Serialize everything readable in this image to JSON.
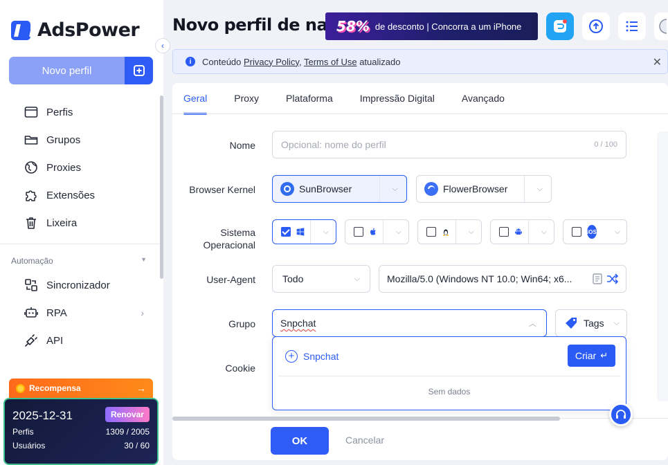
{
  "app": {
    "brand": "AdsPower"
  },
  "sidebar": {
    "new_profile_label": "Novo perfil",
    "items": [
      {
        "label": "Perfis",
        "icon": "profiles-icon"
      },
      {
        "label": "Grupos",
        "icon": "folder-icon"
      },
      {
        "label": "Proxies",
        "icon": "globe-icon"
      },
      {
        "label": "Extensões",
        "icon": "puzzle-icon"
      },
      {
        "label": "Lixeira",
        "icon": "trash-icon"
      }
    ],
    "automation_title": "Automação",
    "automation_items": [
      {
        "label": "Sincronizador",
        "icon": "sync-icon"
      },
      {
        "label": "RPA",
        "icon": "robot-icon"
      },
      {
        "label": "API",
        "icon": "plug-icon"
      }
    ],
    "reward_label": "Recompensa",
    "plan": {
      "date": "2025-12-31",
      "renew_label": "Renovar",
      "profiles_label": "Perfis",
      "profiles_value": "1309 / 2005",
      "users_label": "Usuários",
      "users_value": "30 / 60"
    }
  },
  "header": {
    "title": "Novo perfil de na...",
    "promo_percent": "58%",
    "promo_text": "de desconto | Concorra a um iPhone"
  },
  "notice": {
    "prefix": "Conteúdo",
    "link1": "Privacy Policy",
    "sep": ",",
    "link2": "Terms of Use",
    "suffix": "atualizado"
  },
  "tabs": [
    "Geral",
    "Proxy",
    "Plataforma",
    "Impressão Digital",
    "Avançado"
  ],
  "form": {
    "name_label": "Nome",
    "name_placeholder": "Opcional: nome do perfil",
    "name_counter": "0 / 100",
    "kernel_label": "Browser Kernel",
    "kernel_options": [
      "SunBrowser",
      "FlowerBrowser"
    ],
    "os_label": "Sistema Operacional",
    "os_options": [
      {
        "icon": "windows-icon",
        "checked": true
      },
      {
        "icon": "apple-icon",
        "checked": false
      },
      {
        "icon": "linux-icon",
        "checked": false
      },
      {
        "icon": "android-icon",
        "checked": false
      },
      {
        "icon": "ios-icon",
        "checked": false,
        "text": "iOS"
      }
    ],
    "ua_label": "User-Agent",
    "ua_select": "Todo",
    "ua_value": "Mozilla/5.0 (Windows NT 10.0; Win64; x6...",
    "group_label": "Grupo",
    "group_value": "Snpchat",
    "tags_label": "Tags",
    "cookie_label": "Cookie",
    "dropdown": {
      "create_item": "Snpchat",
      "create_button": "Criar",
      "empty_text": "Sem dados"
    }
  },
  "footer": {
    "ok_label": "OK",
    "cancel_label": "Cancelar"
  },
  "colors": {
    "accent": "#2b5bf5",
    "reward": "#ff6a1a",
    "plan_bg": "#121a3a"
  }
}
